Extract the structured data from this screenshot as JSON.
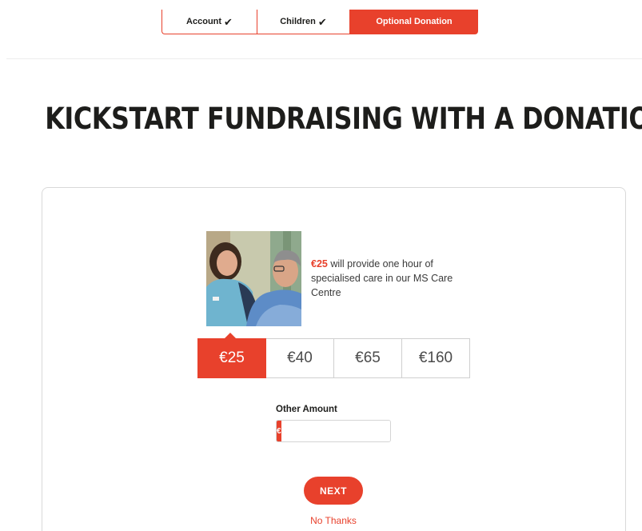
{
  "steps": [
    {
      "label": "Account",
      "check": "✔"
    },
    {
      "label": "Children",
      "check": "✔"
    },
    {
      "label": "Optional Donation"
    }
  ],
  "page_title": "KICKSTART FUNDRAISING WITH A DONATION",
  "impact": {
    "amount": "€25",
    "text": " will provide one hour of specialised care in our MS Care Centre"
  },
  "amounts": [
    "€25",
    "€40",
    "€65",
    "€160"
  ],
  "selected_amount": "€25",
  "other_amount": {
    "label": "Other Amount",
    "currency": "€",
    "value": ""
  },
  "next_label": "NEXT",
  "no_thanks_label": "No Thanks",
  "colors": {
    "accent": "#e8412c"
  }
}
